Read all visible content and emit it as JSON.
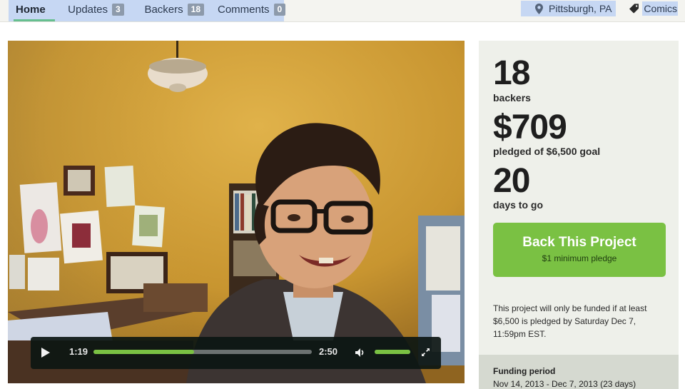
{
  "nav": {
    "tabs": [
      {
        "label": "Home",
        "count": ""
      },
      {
        "label": "Updates",
        "count": "3"
      },
      {
        "label": "Backers",
        "count": "18"
      },
      {
        "label": "Comments",
        "count": "0"
      }
    ],
    "location": "Pittsburgh, PA",
    "category": "Comics"
  },
  "video": {
    "current_time": "1:19",
    "duration": "2:50",
    "progress_fraction": 0.46,
    "volume_fraction": 1.0
  },
  "stats": {
    "backers_count": "18",
    "backers_label": "backers",
    "pledged_amount": "$709",
    "pledged_label": "pledged of $6,500 goal",
    "days_count": "20",
    "days_label": "days to go"
  },
  "cta": {
    "label": "Back This Project",
    "sublabel": "$1 minimum pledge"
  },
  "funding_note": "This project will only be funded if at least $6,500 is pledged by Saturday Dec 7, 11:59pm EST.",
  "funding_period": {
    "title": "Funding period",
    "value": "Nov 14, 2013 - Dec 7, 2013 (23 days)"
  },
  "colors": {
    "accent_green": "#7ac143",
    "nav_highlight": "#c6d7f3",
    "panel_bg": "#eef0ea"
  }
}
